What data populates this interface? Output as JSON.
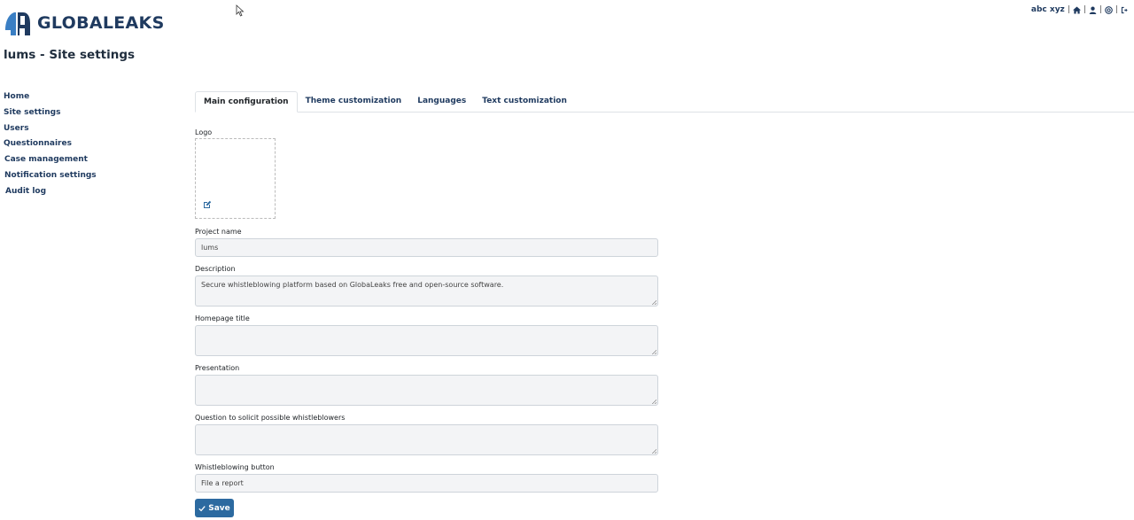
{
  "brand": {
    "name": "GLOBALEAKS",
    "logo_icon": "globaleaks-logo-icon"
  },
  "user_menu": {
    "username": "abc xyz",
    "separator": "|",
    "icons": [
      "home-icon",
      "user-icon",
      "support-icon",
      "logout-icon"
    ]
  },
  "page": {
    "title": "lums - Site settings"
  },
  "sidebar": {
    "items": [
      {
        "label": "Home"
      },
      {
        "label": "Site settings"
      },
      {
        "label": "Users"
      },
      {
        "label": "Questionnaires"
      },
      {
        "label": "Case management"
      },
      {
        "label": "Notification settings"
      },
      {
        "label": "Audit log"
      }
    ]
  },
  "tabs": [
    {
      "label": "Main configuration",
      "active": true
    },
    {
      "label": "Theme customization"
    },
    {
      "label": "Languages"
    },
    {
      "label": "Text customization"
    }
  ],
  "form": {
    "logo_label": "Logo",
    "project_name": {
      "label": "Project name",
      "value": "lums"
    },
    "description": {
      "label": "Description",
      "value": "Secure whistleblowing platform based on GlobaLeaks free and open-source software."
    },
    "homepage_title": {
      "label": "Homepage title",
      "value": ""
    },
    "presentation": {
      "label": "Presentation",
      "value": ""
    },
    "question": {
      "label": "Question to solicit possible whistleblowers",
      "value": ""
    },
    "whistleblowing_button": {
      "label": "Whistleblowing button",
      "value": "File a report"
    },
    "save_label": "Save"
  },
  "colors": {
    "brand": "#1f3a5f",
    "primary_button": "#2c6aa0",
    "field_bg": "#f3f4f6"
  }
}
